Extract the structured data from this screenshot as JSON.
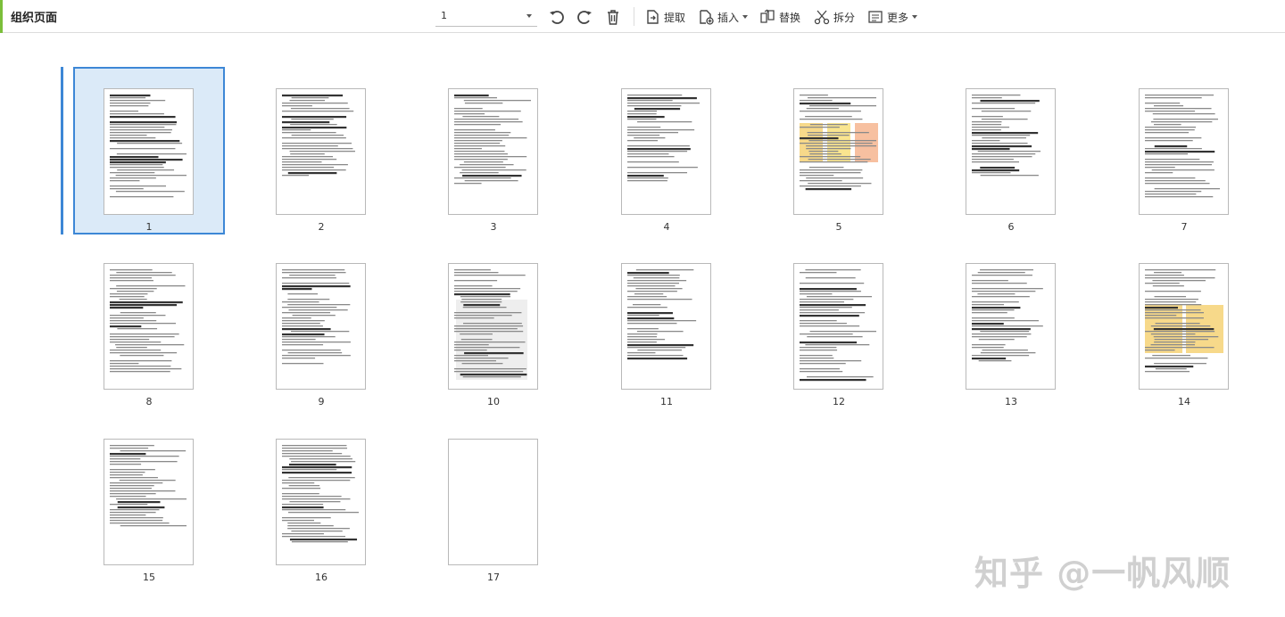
{
  "toolbar": {
    "title": "组织页面",
    "page_selector_value": "1",
    "icons": [
      "rotate-left-icon",
      "rotate-right-icon",
      "trash-icon"
    ],
    "buttons": {
      "extract": "提取",
      "insert": "插入",
      "replace": "替换",
      "split": "拆分",
      "more": "更多"
    },
    "accent_color": "#7bbf3a"
  },
  "pages": [
    {
      "number": "1",
      "selected": true
    },
    {
      "number": "2"
    },
    {
      "number": "3"
    },
    {
      "number": "4"
    },
    {
      "number": "5"
    },
    {
      "number": "6"
    },
    {
      "number": "7"
    },
    {
      "number": "8"
    },
    {
      "number": "9"
    },
    {
      "number": "10"
    },
    {
      "number": "11"
    },
    {
      "number": "12"
    },
    {
      "number": "13"
    },
    {
      "number": "14"
    },
    {
      "number": "15"
    },
    {
      "number": "16"
    },
    {
      "number": "17"
    }
  ],
  "selection_color": "#3d87d6",
  "watermark": "知乎 @一帆风顺"
}
